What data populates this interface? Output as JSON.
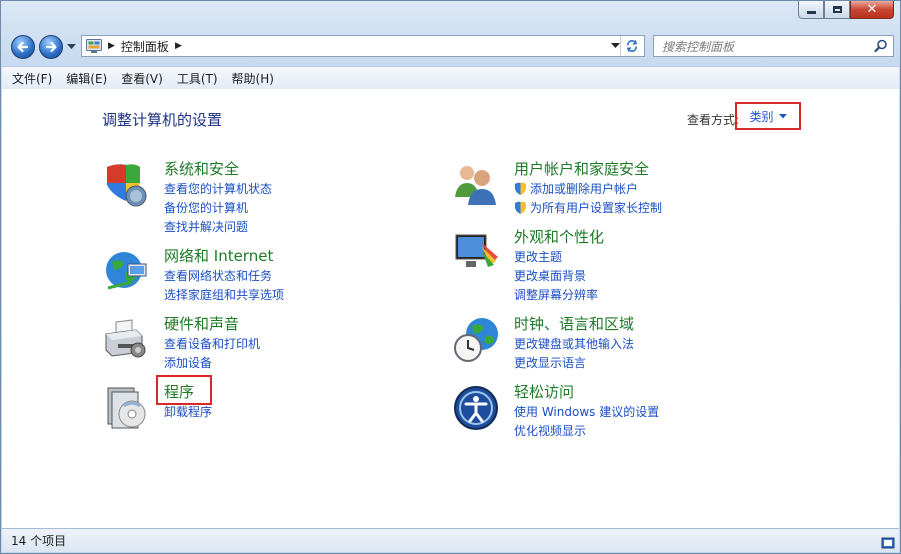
{
  "window": {
    "caption_buttons": [
      "minimize",
      "maximize",
      "close"
    ],
    "close_color": "#c94734"
  },
  "address_bar": {
    "breadcrumb": [
      "控制面板"
    ],
    "search_placeholder": "搜索控制面板"
  },
  "menu": {
    "items": [
      "文件(F)",
      "编辑(E)",
      "查看(V)",
      "工具(T)",
      "帮助(H)"
    ]
  },
  "content": {
    "title": "调整计算机的设置",
    "view_by_label": "查看方式:",
    "view_by_value": "类别",
    "categories_left": [
      {
        "title": "系统和安全",
        "icon": "shield-globe-icon",
        "links": [
          "查看您的计算机状态",
          "备份您的计算机",
          "查找并解决问题"
        ]
      },
      {
        "title": "网络和 Internet",
        "icon": "network-globe-icon",
        "links": [
          "查看网络状态和任务",
          "选择家庭组和共享选项"
        ]
      },
      {
        "title": "硬件和声音",
        "icon": "printer-icon",
        "links": [
          "查看设备和打印机",
          "添加设备"
        ]
      },
      {
        "title": "程序",
        "icon": "programs-disc-icon",
        "links": [
          "卸载程序"
        ]
      }
    ],
    "categories_right": [
      {
        "title": "用户帐户和家庭安全",
        "icon": "users-icon",
        "links": [
          "添加或删除用户帐户",
          "为所有用户设置家长控制"
        ]
      },
      {
        "title": "外观和个性化",
        "icon": "monitor-palette-icon",
        "links": [
          "更改主题",
          "更改桌面背景",
          "调整屏幕分辨率"
        ]
      },
      {
        "title": "时钟、语言和区域",
        "icon": "clock-globe-icon",
        "links": [
          "更改键盘或其他输入法",
          "更改显示语言"
        ]
      },
      {
        "title": "轻松访问",
        "icon": "ease-of-access-icon",
        "links": [
          "使用 Windows 建议的设置",
          "优化视频显示"
        ]
      }
    ],
    "highlight_color": "#d62a2a",
    "link_color": "#1a4fc4",
    "category_title_color": "#1d7a27"
  },
  "status": {
    "text": "14 个项目"
  }
}
